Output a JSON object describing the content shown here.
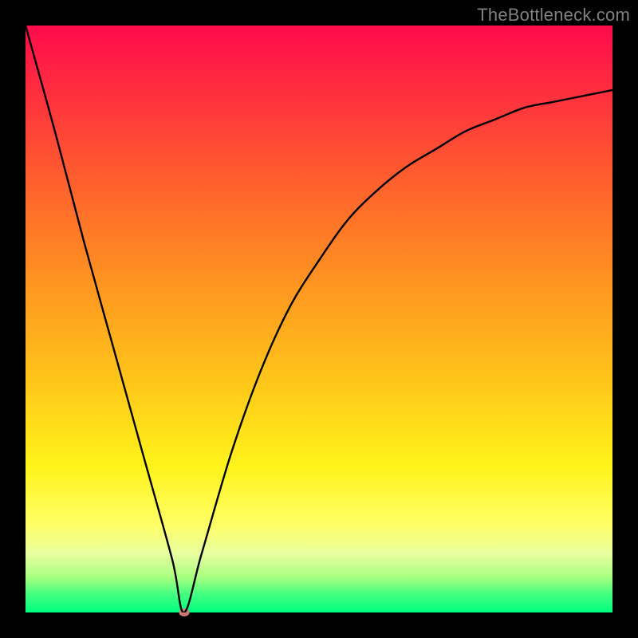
{
  "watermark": "TheBottleneck.com",
  "colors": {
    "background": "#000000",
    "watermark_text": "#808080",
    "curve_stroke": "#000000",
    "dot_fill": "#d07a78",
    "gradient_top": "#ff0b4c",
    "gradient_bottom": "#00ff7f"
  },
  "chart_data": {
    "type": "line",
    "title": "",
    "xlabel": "",
    "ylabel": "",
    "xlim": [
      0,
      100
    ],
    "ylim": [
      0,
      100
    ],
    "grid": false,
    "legend": false,
    "series": [
      {
        "name": "bottleneck-curve",
        "x": [
          0,
          5,
          10,
          15,
          20,
          25,
          27,
          30,
          35,
          40,
          45,
          50,
          55,
          60,
          65,
          70,
          75,
          80,
          85,
          90,
          95,
          100
        ],
        "y": [
          100,
          82,
          63,
          45,
          27,
          9,
          0,
          10,
          27,
          41,
          52,
          60,
          67,
          72,
          76,
          79,
          82,
          84,
          86,
          87,
          88,
          89
        ]
      }
    ],
    "annotations": [
      {
        "name": "minimum-dot",
        "x": 27,
        "y": 0
      }
    ]
  }
}
